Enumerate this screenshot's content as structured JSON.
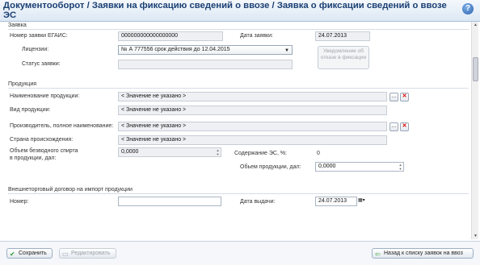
{
  "title": "Документооборот / Заявки на фиксацию сведений о ввозе / Заявка о фиксации сведений о ввозе ЭС",
  "help_icon": "question-icon",
  "sections": {
    "request": "Заявка",
    "products": "Продукция",
    "contract": "Внешнеторговый договор на импорт продукции"
  },
  "request": {
    "number_label": "Номер заявки ЕГАИС:",
    "number_value": "000000000000000000",
    "date_label": "Дата заявки:",
    "date_value": "24.07.2013",
    "licenses_label": "Лицензии:",
    "licenses_value": "№ А 777556 срок действия до 12.04.2015",
    "status_label": "Статус заявки:",
    "status_value": "",
    "notice_button": "Уведомление об отказе в фиксации"
  },
  "products": {
    "name_label": "Наименование продукции:",
    "name_value": "< Значение не указано >",
    "type_label": "Вид продукции:",
    "type_value": "< Значение не указано >",
    "producer_label": "Производитель, полное наименование:",
    "producer_value": "< Значение не указано >",
    "country_label": "Страна происхождения:",
    "country_value": "< Значение не указано >",
    "spirit_label_1": "Объем безводного спирта",
    "spirit_label_2": "в продукции, дал:",
    "spirit_value": "0,0000",
    "es_label": "Содержание ЭС, %:",
    "es_value": "0",
    "volume_label": "Обьем продукции, дал:",
    "volume_value": "0,0000"
  },
  "contract": {
    "number_label": "Номер:",
    "number_value": "",
    "issue_label": "Дата выдачи:",
    "issue_value": "24.07.2013"
  },
  "footer": {
    "save": "Сохранить",
    "edit": "Редактировать",
    "back": "Назад к списку заявок на ввоз"
  },
  "colors": {
    "title": "#1a3f73",
    "delete": "#d00000",
    "save_check": "#2e9d2e"
  }
}
